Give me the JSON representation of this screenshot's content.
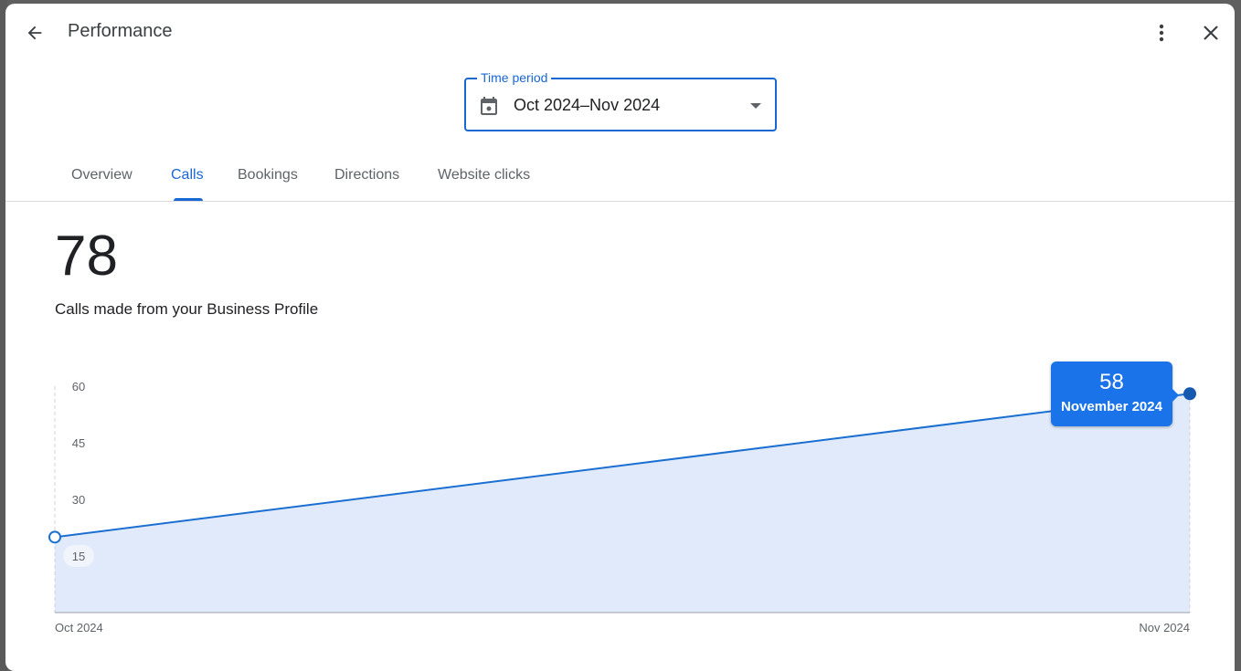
{
  "header": {
    "title": "Performance",
    "back_icon": "arrow-left-icon",
    "more_icon": "more-vert-icon",
    "close_icon": "close-icon"
  },
  "time_period": {
    "label": "Time period",
    "value": "Oct 2024–Nov 2024",
    "icon": "calendar-icon"
  },
  "tabs": [
    {
      "label": "Overview",
      "active": false
    },
    {
      "label": "Calls",
      "active": true
    },
    {
      "label": "Bookings",
      "active": false
    },
    {
      "label": "Directions",
      "active": false
    },
    {
      "label": "Website clicks",
      "active": false
    }
  ],
  "metric": {
    "value": "78",
    "caption": "Calls made from your Business Profile"
  },
  "tooltip": {
    "value": "58",
    "label": "November 2024"
  },
  "colors": {
    "accent": "#1967d2",
    "line": "#1a6fd1",
    "area": "#e1eafa",
    "tooltip_bg": "#1a73e8",
    "point_active": "#1558b0"
  },
  "chart_data": {
    "type": "area",
    "title": "",
    "xlabel": "",
    "ylabel": "",
    "x": [
      "Oct 2024",
      "Nov 2024"
    ],
    "series": [
      {
        "name": "Calls",
        "values": [
          20,
          58
        ]
      }
    ],
    "yticks": [
      15,
      30,
      45,
      60
    ],
    "ylim": [
      0,
      60
    ],
    "grid": false,
    "highlighted_tick": 15,
    "active_point": "Nov 2024"
  }
}
